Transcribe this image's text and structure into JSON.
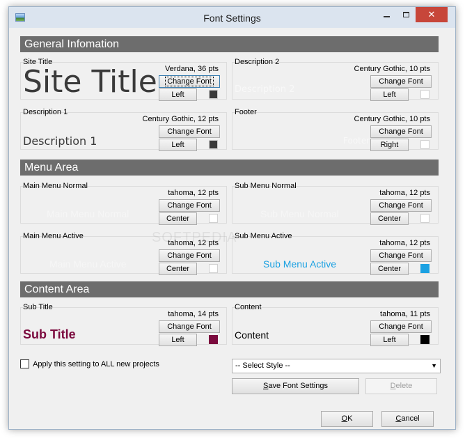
{
  "window": {
    "title": "Font Settings",
    "close_glyph": "✕"
  },
  "colors": {
    "header_bg": "#6d6d6d",
    "sub_menu_active": "#1ba1e2",
    "sub_title": "#7b0a3e",
    "dark_swatch": "#3a3a3a",
    "black_swatch": "#000000",
    "white_swatch": "#ffffff"
  },
  "sections": {
    "general": "General Infomation",
    "menu": "Menu Area",
    "content": "Content Area"
  },
  "panels": {
    "site_title": {
      "title": "Site Title",
      "font_info": "Verdana, 36 pts",
      "change_label": "Change Font",
      "align_label": "Left",
      "preview": "Site Title"
    },
    "description2": {
      "title": "Description 2",
      "font_info": "Century Gothic, 10 pts",
      "change_label": "Change Font",
      "align_label": "Left",
      "preview": "Description 2"
    },
    "description1": {
      "title": "Description 1",
      "font_info": "Century Gothic, 12 pts",
      "change_label": "Change Font",
      "align_label": "Left",
      "preview": "Description 1"
    },
    "footer": {
      "title": "Footer",
      "font_info": "Century Gothic, 10 pts",
      "change_label": "Change Font",
      "align_label": "Right",
      "preview": "Footer"
    },
    "main_menu_normal": {
      "title": "Main Menu Normal",
      "font_info": "tahoma, 12 pts",
      "change_label": "Change Font",
      "align_label": "Center",
      "preview": "Main Menu Normal"
    },
    "sub_menu_normal": {
      "title": "Sub Menu Normal",
      "font_info": "tahoma, 12 pts",
      "change_label": "Change Font",
      "align_label": "Center",
      "preview": "Sub Menu Normal"
    },
    "main_menu_active": {
      "title": "Main Menu Active",
      "font_info": "tahoma, 12 pts",
      "change_label": "Change Font",
      "align_label": "Center",
      "preview": "Main Menu Active"
    },
    "sub_menu_active": {
      "title": "Sub Menu Active",
      "font_info": "tahoma, 12 pts",
      "change_label": "Change Font",
      "align_label": "Center",
      "preview": "Sub Menu Active"
    },
    "sub_title": {
      "title": "Sub Title",
      "font_info": "tahoma, 14 pts",
      "change_label": "Change Font",
      "align_label": "Left",
      "preview": "Sub Title"
    },
    "content": {
      "title": "Content",
      "font_info": "tahoma, 11 pts",
      "change_label": "Change Font",
      "align_label": "Left",
      "preview": "Content"
    }
  },
  "apply_all": {
    "label": "Apply this setting to ALL new projects",
    "checked": false
  },
  "style_select": {
    "value": "-- Select Style --"
  },
  "buttons": {
    "save_prefix": "S",
    "save_rest": "ave Font Settings",
    "delete_prefix": "D",
    "delete_rest": "elete",
    "ok_prefix": "O",
    "ok_rest": "K",
    "cancel_prefix": "C",
    "cancel_rest": "ancel"
  },
  "watermark": "SOFTPEDIA"
}
